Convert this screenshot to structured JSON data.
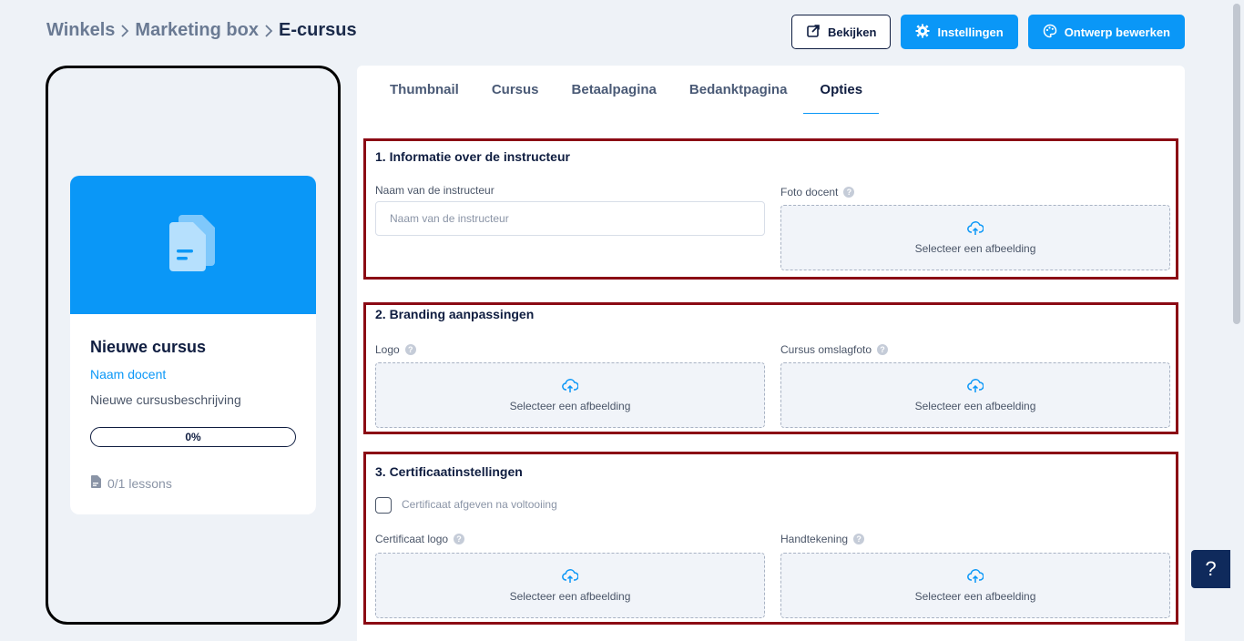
{
  "breadcrumb": {
    "items": [
      "Winkels",
      "Marketing box"
    ],
    "current": "E-cursus"
  },
  "actions": {
    "view": "Bekijken",
    "settings": "Instellingen",
    "edit_design": "Ontwerp bewerken"
  },
  "preview": {
    "title": "Nieuwe cursus",
    "teacher": "Naam docent",
    "description": "Nieuwe cursusbeschrijving",
    "progress": "0%",
    "lessons": "0/1 lessons"
  },
  "tabs": [
    "Thumbnail",
    "Cursus",
    "Betaalpagina",
    "Bedanktpagina",
    "Opties"
  ],
  "sections": {
    "instructor": {
      "title": "1. Informatie over de instructeur",
      "name_label": "Naam van de instructeur",
      "name_placeholder": "Naam van de instructeur",
      "photo_label": "Foto docent",
      "upload": "Selecteer een afbeelding"
    },
    "branding": {
      "title": "2. Branding aanpassingen",
      "logo_label": "Logo",
      "cover_label": "Cursus omslagfoto",
      "upload": "Selecteer een afbeelding"
    },
    "certificate": {
      "title": "3. Certificaatinstellingen",
      "checkbox_label": "Certificaat afgeven na voltooiing",
      "logo_label": "Certificaat logo",
      "signature_label": "Handtekening",
      "upload": "Selecteer een afbeelding"
    }
  },
  "help_button": "?"
}
